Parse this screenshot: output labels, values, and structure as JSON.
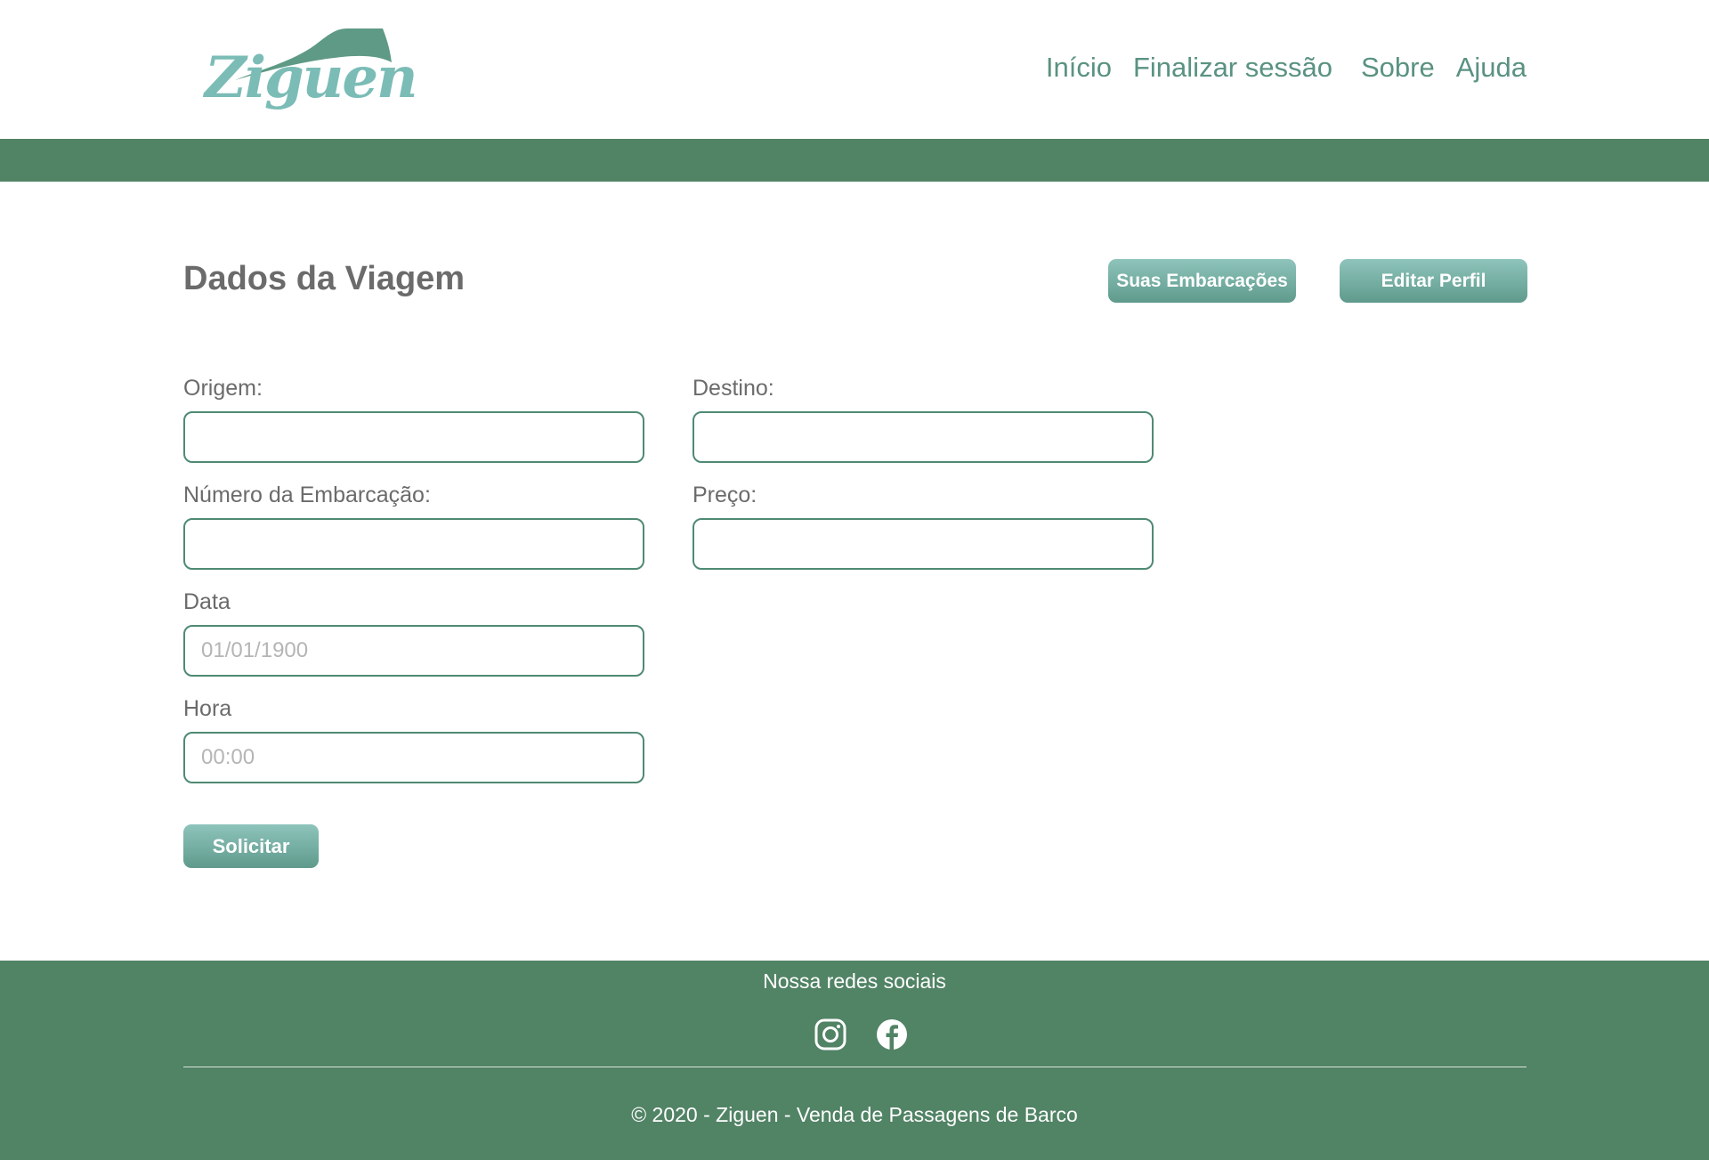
{
  "brand": {
    "logo_text": "Ziguen",
    "colors": {
      "primary_green": "#518365",
      "logo_teal": "#7bbcb6",
      "logo_wave": "#5e9a86",
      "input_border": "#4f8a73",
      "button_gradient_top": "#8ec4bb",
      "button_gradient_bottom": "#5f9a8c"
    }
  },
  "nav": {
    "items": [
      {
        "label": "Início"
      },
      {
        "label": "Finalizar sessão"
      },
      {
        "label": "Sobre"
      },
      {
        "label": "Ajuda"
      }
    ]
  },
  "main": {
    "title": "Dados da Viagem",
    "buttons": {
      "embarcacoes": "Suas Embarcações",
      "perfil": "Editar Perfil",
      "submit": "Solicitar"
    },
    "fields": {
      "origem": {
        "label": "Origem:",
        "value": "",
        "placeholder": ""
      },
      "destino": {
        "label": "Destino:",
        "value": "",
        "placeholder": ""
      },
      "numero": {
        "label": "Número da Embarcação:",
        "value": "",
        "placeholder": ""
      },
      "preco": {
        "label": "Preço:",
        "value": "",
        "placeholder": ""
      },
      "data": {
        "label": "Data",
        "value": "",
        "placeholder": "01/01/1900"
      },
      "hora": {
        "label": "Hora",
        "value": "",
        "placeholder": "00:00"
      }
    }
  },
  "footer": {
    "social_title": "Nossa redes sociais",
    "social_icons": [
      "instagram-icon",
      "facebook-icon"
    ],
    "copyright": "© 2020 - Ziguen - Venda de Passagens de Barco"
  }
}
